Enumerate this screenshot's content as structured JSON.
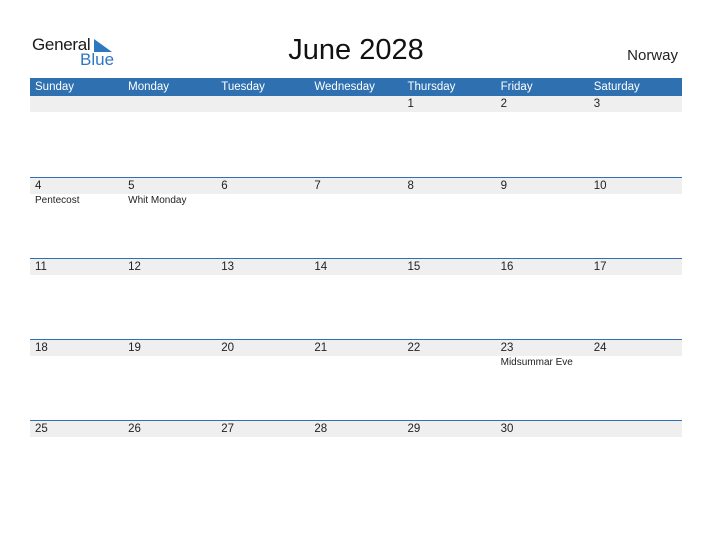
{
  "logo": {
    "line1": "General",
    "line2": "Blue"
  },
  "title": "June 2028",
  "country": "Norway",
  "weekdays": [
    "Sunday",
    "Monday",
    "Tuesday",
    "Wednesday",
    "Thursday",
    "Friday",
    "Saturday"
  ],
  "weeks": [
    [
      {
        "d": "",
        "e": ""
      },
      {
        "d": "",
        "e": ""
      },
      {
        "d": "",
        "e": ""
      },
      {
        "d": "",
        "e": ""
      },
      {
        "d": "1",
        "e": ""
      },
      {
        "d": "2",
        "e": ""
      },
      {
        "d": "3",
        "e": ""
      }
    ],
    [
      {
        "d": "4",
        "e": "Pentecost"
      },
      {
        "d": "5",
        "e": "Whit Monday"
      },
      {
        "d": "6",
        "e": ""
      },
      {
        "d": "7",
        "e": ""
      },
      {
        "d": "8",
        "e": ""
      },
      {
        "d": "9",
        "e": ""
      },
      {
        "d": "10",
        "e": ""
      }
    ],
    [
      {
        "d": "11",
        "e": ""
      },
      {
        "d": "12",
        "e": ""
      },
      {
        "d": "13",
        "e": ""
      },
      {
        "d": "14",
        "e": ""
      },
      {
        "d": "15",
        "e": ""
      },
      {
        "d": "16",
        "e": ""
      },
      {
        "d": "17",
        "e": ""
      }
    ],
    [
      {
        "d": "18",
        "e": ""
      },
      {
        "d": "19",
        "e": ""
      },
      {
        "d": "20",
        "e": ""
      },
      {
        "d": "21",
        "e": ""
      },
      {
        "d": "22",
        "e": ""
      },
      {
        "d": "23",
        "e": "Midsummar Eve"
      },
      {
        "d": "24",
        "e": ""
      }
    ],
    [
      {
        "d": "25",
        "e": ""
      },
      {
        "d": "26",
        "e": ""
      },
      {
        "d": "27",
        "e": ""
      },
      {
        "d": "28",
        "e": ""
      },
      {
        "d": "29",
        "e": ""
      },
      {
        "d": "30",
        "e": ""
      },
      {
        "d": "",
        "e": ""
      }
    ]
  ]
}
